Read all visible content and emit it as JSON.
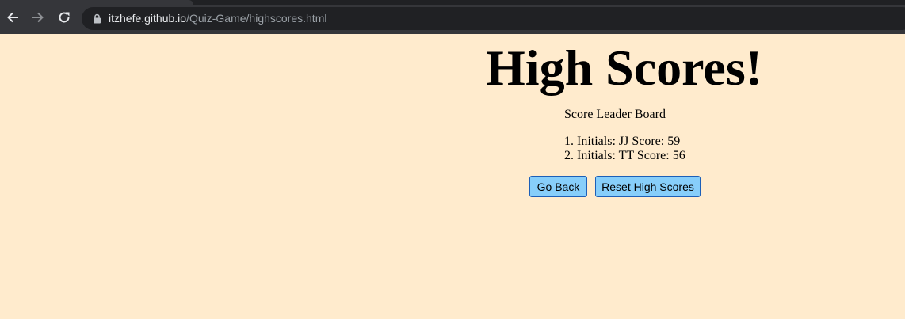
{
  "browser": {
    "url_host": "itzhefe.github.io",
    "url_path": "/Quiz-Game/highscores.html"
  },
  "page": {
    "heading": "High Scores!",
    "board_title": "Score Leader Board",
    "scores": [
      "1. Initials: JJ Score: 59",
      "2. Initials: TT Score: 56"
    ],
    "buttons": {
      "go_back": "Go Back",
      "reset": "Reset High Scores"
    }
  },
  "colors": {
    "page_background": "#ffebcd",
    "button_background": "#87cefa",
    "chrome_background": "#35363a"
  }
}
